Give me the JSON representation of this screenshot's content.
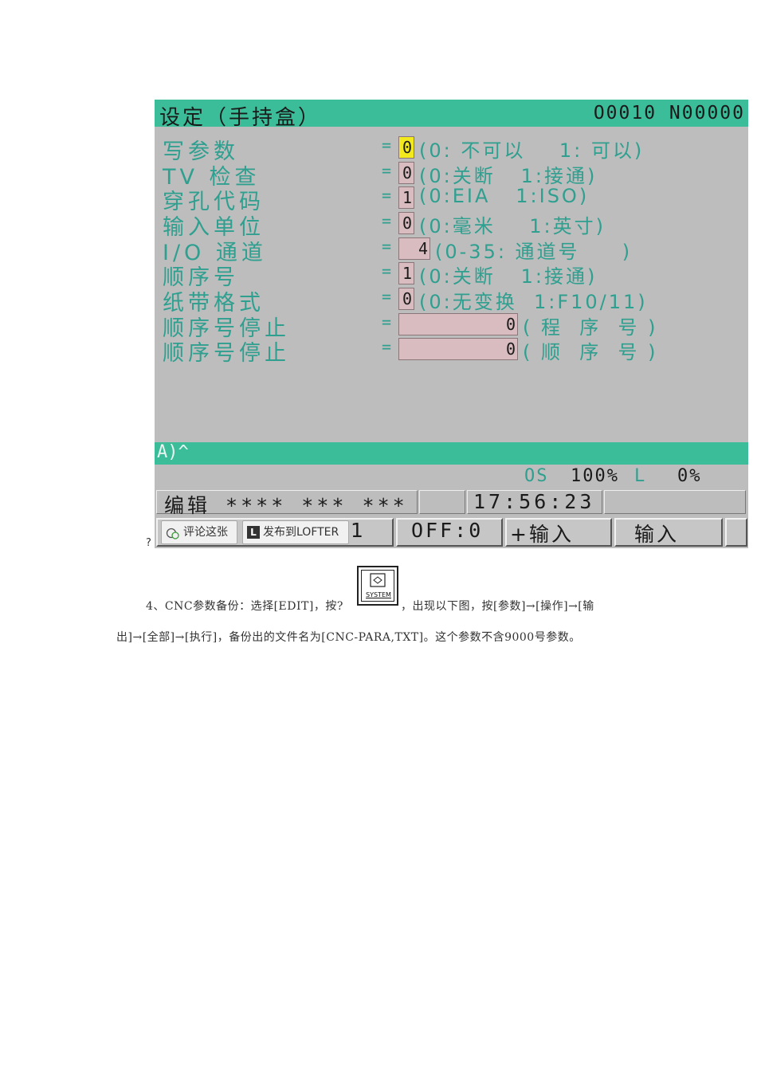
{
  "screen": {
    "title": "设定（手持盒）",
    "program_number": "O0010 N00000",
    "rows": [
      {
        "label": "写参数",
        "eq": "=",
        "value": "0",
        "desc": "(0: 不可以    1: 可以)"
      },
      {
        "label": "TV  检查",
        "eq": "=",
        "value": "0",
        "desc": "(0:关断   1:接通)"
      },
      {
        "label": "穿孔代码",
        "eq": "=",
        "value": "1",
        "desc": "(0:EIA   1:ISO)"
      },
      {
        "label": "输入单位",
        "eq": "=",
        "value": "0",
        "desc": "(0:毫米    1:英寸)"
      },
      {
        "label": "I/O  通道",
        "eq": "=",
        "value": "4",
        "desc": "(0-35: 通道号     )"
      },
      {
        "label": "顺序号",
        "eq": "=",
        "value": "1",
        "desc": "(0:关断   1:接通)"
      },
      {
        "label": "纸带格式",
        "eq": "=",
        "value": "0",
        "desc": "(0:无变换  1:F10/11)"
      },
      {
        "label": "顺序号停止",
        "eq": "=",
        "value": "0",
        "desc": "( 程  序  号 )"
      },
      {
        "label": "顺序号停止",
        "eq": "=",
        "value": "0",
        "desc": "( 顺  序  号 )"
      }
    ],
    "prompt": "A)^",
    "status": {
      "os": "OS",
      "override": "100%",
      "l_label": "L",
      "l_value": "0%"
    },
    "mode": "编辑 **** *** ***",
    "time": "17:56:23",
    "softkeys": {
      "key1_partial": "1",
      "off": "OFF:0",
      "plus_input": "+输入",
      "input": "输入"
    }
  },
  "overlay": {
    "comment_btn": "评论这张",
    "publish_btn": "发布到LOFTER",
    "publish_icon": "L"
  },
  "question_mark": "?",
  "system_key": {
    "label": "SYSTEM"
  },
  "paragraph": {
    "line1_pre": "4、CNC参数备份：选择[EDIT]，按?",
    "line1_post": "，出现以下图，按[参数]→[操作]→[输",
    "line2": "出]→[全部]→[执行]，备份出的文件名为[CNC-PARA,TXT]。这个参数不含9000号参数。"
  },
  "colors": {
    "teal": "#3bbd9a",
    "label_teal": "#2f9f8f",
    "panel_gray": "#bdbdbd",
    "value_box": "#d9bcc0",
    "highlight": "#f2ea1c"
  }
}
